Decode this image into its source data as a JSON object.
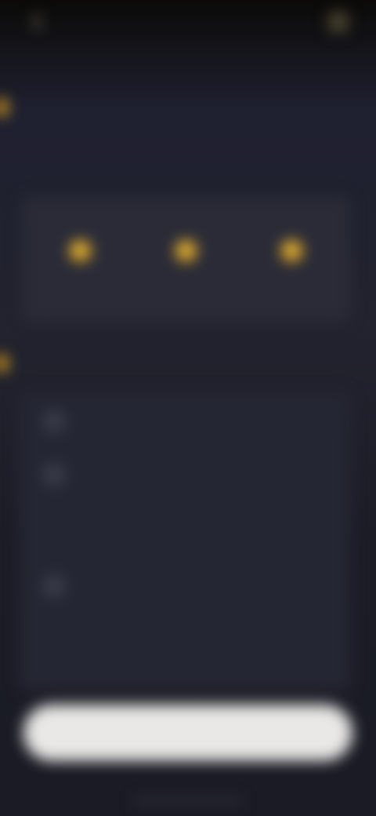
{
  "topbar": {
    "title": "",
    "action_label": ""
  },
  "sections": {
    "levels_title": "",
    "rules_title": ""
  },
  "subtitle": "",
  "levels": [
    {
      "name": "",
      "value": ""
    },
    {
      "name": "",
      "value": ""
    },
    {
      "name": "",
      "value": ""
    }
  ],
  "rules": [
    {
      "num": "",
      "text": ""
    },
    {
      "num": "",
      "text": ""
    },
    {
      "num": "",
      "text": ""
    }
  ],
  "cta_label": "",
  "colors": {
    "accent": "#e0a21a",
    "background": "#1f2030",
    "card": "#2a2b37",
    "button": "#e9e8e6"
  }
}
